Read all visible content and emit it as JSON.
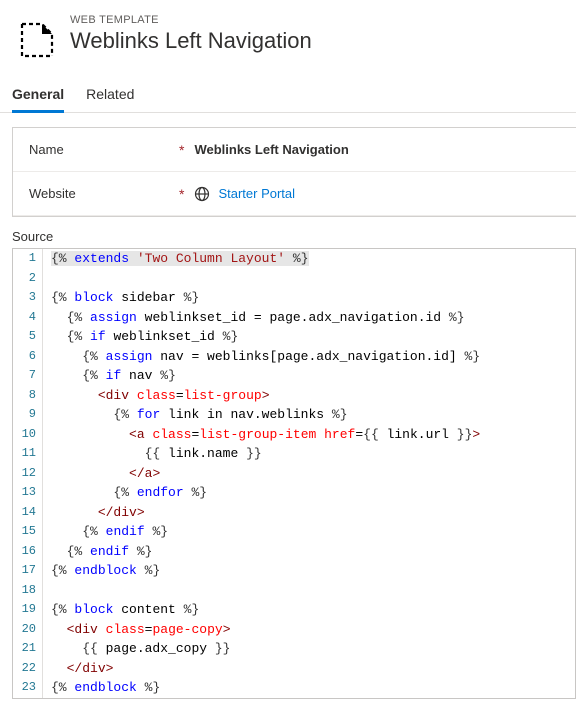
{
  "header": {
    "category": "WEB TEMPLATE",
    "title": "Weblinks Left Navigation"
  },
  "tabs": {
    "general": "General",
    "related": "Related"
  },
  "form": {
    "name_label": "Name",
    "name_value": "Weblinks Left Navigation",
    "website_label": "Website",
    "website_value": "Starter Portal",
    "required": "*"
  },
  "source_label": "Source",
  "code_lines": [
    {
      "n": "1",
      "tokens": [
        {
          "t": "{%",
          "c": "grey",
          "bg": true
        },
        {
          "t": " ",
          "bg": true
        },
        {
          "t": "extends",
          "c": "kw",
          "bg": true
        },
        {
          "t": " ",
          "bg": true
        },
        {
          "t": "'Two Column Layout'",
          "c": "val",
          "bg": true
        },
        {
          "t": " ",
          "bg": true
        },
        {
          "t": "%}",
          "c": "grey",
          "bg": true
        }
      ]
    },
    {
      "n": "2",
      "tokens": []
    },
    {
      "n": "3",
      "tokens": [
        {
          "t": "{%",
          "c": "grey"
        },
        {
          "t": " "
        },
        {
          "t": "block",
          "c": "kw"
        },
        {
          "t": " sidebar ",
          "c": "txt"
        },
        {
          "t": "%}",
          "c": "grey"
        }
      ]
    },
    {
      "n": "4",
      "tokens": [
        {
          "t": "  "
        },
        {
          "t": "{%",
          "c": "grey"
        },
        {
          "t": " "
        },
        {
          "t": "assign",
          "c": "kw"
        },
        {
          "t": " weblinkset_id = page.adx_navigation.id ",
          "c": "txt"
        },
        {
          "t": "%}",
          "c": "grey"
        }
      ]
    },
    {
      "n": "5",
      "tokens": [
        {
          "t": "  "
        },
        {
          "t": "{%",
          "c": "grey"
        },
        {
          "t": " "
        },
        {
          "t": "if",
          "c": "kw"
        },
        {
          "t": " weblinkset_id ",
          "c": "txt"
        },
        {
          "t": "%}",
          "c": "grey"
        }
      ]
    },
    {
      "n": "6",
      "tokens": [
        {
          "t": "    "
        },
        {
          "t": "{%",
          "c": "grey"
        },
        {
          "t": " "
        },
        {
          "t": "assign",
          "c": "kw"
        },
        {
          "t": " nav = weblinks[page.adx_navigation.id] ",
          "c": "txt"
        },
        {
          "t": "%}",
          "c": "grey"
        }
      ]
    },
    {
      "n": "7",
      "tokens": [
        {
          "t": "    "
        },
        {
          "t": "{%",
          "c": "grey"
        },
        {
          "t": " "
        },
        {
          "t": "if",
          "c": "kw"
        },
        {
          "t": " nav ",
          "c": "txt"
        },
        {
          "t": "%}",
          "c": "grey"
        }
      ]
    },
    {
      "n": "8",
      "tokens": [
        {
          "t": "      "
        },
        {
          "t": "<",
          "c": "tag"
        },
        {
          "t": "div",
          "c": "tag"
        },
        {
          "t": " "
        },
        {
          "t": "class",
          "c": "attr"
        },
        {
          "t": "=",
          "c": "txt"
        },
        {
          "t": "list-group",
          "c": "attr"
        },
        {
          "t": ">",
          "c": "tag"
        }
      ]
    },
    {
      "n": "9",
      "tokens": [
        {
          "t": "        "
        },
        {
          "t": "{%",
          "c": "grey"
        },
        {
          "t": " "
        },
        {
          "t": "for",
          "c": "kw"
        },
        {
          "t": " link in nav.weblinks ",
          "c": "txt"
        },
        {
          "t": "%}",
          "c": "grey"
        }
      ]
    },
    {
      "n": "10",
      "tokens": [
        {
          "t": "          "
        },
        {
          "t": "<",
          "c": "tag"
        },
        {
          "t": "a",
          "c": "tag"
        },
        {
          "t": " "
        },
        {
          "t": "class",
          "c": "attr"
        },
        {
          "t": "=",
          "c": "txt"
        },
        {
          "t": "list-group-item",
          "c": "attr"
        },
        {
          "t": " "
        },
        {
          "t": "href",
          "c": "attr"
        },
        {
          "t": "=",
          "c": "txt"
        },
        {
          "t": "{{",
          "c": "grey"
        },
        {
          "t": " link.url ",
          "c": "txt"
        },
        {
          "t": "}}",
          "c": "grey"
        },
        {
          "t": ">",
          "c": "tag"
        }
      ]
    },
    {
      "n": "11",
      "tokens": [
        {
          "t": "            "
        },
        {
          "t": "{{",
          "c": "grey"
        },
        {
          "t": " link.name ",
          "c": "txt"
        },
        {
          "t": "}}",
          "c": "grey"
        }
      ]
    },
    {
      "n": "12",
      "tokens": [
        {
          "t": "          "
        },
        {
          "t": "</",
          "c": "tag"
        },
        {
          "t": "a",
          "c": "tag"
        },
        {
          "t": ">",
          "c": "tag"
        }
      ]
    },
    {
      "n": "13",
      "tokens": [
        {
          "t": "        "
        },
        {
          "t": "{%",
          "c": "grey"
        },
        {
          "t": " "
        },
        {
          "t": "endfor",
          "c": "kw"
        },
        {
          "t": " "
        },
        {
          "t": "%}",
          "c": "grey"
        }
      ]
    },
    {
      "n": "14",
      "tokens": [
        {
          "t": "      "
        },
        {
          "t": "</",
          "c": "tag"
        },
        {
          "t": "div",
          "c": "tag"
        },
        {
          "t": ">",
          "c": "tag"
        }
      ]
    },
    {
      "n": "15",
      "tokens": [
        {
          "t": "    "
        },
        {
          "t": "{%",
          "c": "grey"
        },
        {
          "t": " "
        },
        {
          "t": "endif",
          "c": "kw"
        },
        {
          "t": " "
        },
        {
          "t": "%}",
          "c": "grey"
        }
      ]
    },
    {
      "n": "16",
      "tokens": [
        {
          "t": "  "
        },
        {
          "t": "{%",
          "c": "grey"
        },
        {
          "t": " "
        },
        {
          "t": "endif",
          "c": "kw"
        },
        {
          "t": " "
        },
        {
          "t": "%}",
          "c": "grey"
        }
      ]
    },
    {
      "n": "17",
      "tokens": [
        {
          "t": "{%",
          "c": "grey"
        },
        {
          "t": " "
        },
        {
          "t": "endblock",
          "c": "kw"
        },
        {
          "t": " "
        },
        {
          "t": "%}",
          "c": "grey"
        }
      ]
    },
    {
      "n": "18",
      "tokens": []
    },
    {
      "n": "19",
      "tokens": [
        {
          "t": "{%",
          "c": "grey"
        },
        {
          "t": " "
        },
        {
          "t": "block",
          "c": "kw"
        },
        {
          "t": " content ",
          "c": "txt"
        },
        {
          "t": "%}",
          "c": "grey"
        }
      ]
    },
    {
      "n": "20",
      "tokens": [
        {
          "t": "  "
        },
        {
          "t": "<",
          "c": "tag"
        },
        {
          "t": "div",
          "c": "tag"
        },
        {
          "t": " "
        },
        {
          "t": "class",
          "c": "attr"
        },
        {
          "t": "=",
          "c": "txt"
        },
        {
          "t": "page-copy",
          "c": "attr"
        },
        {
          "t": ">",
          "c": "tag"
        }
      ]
    },
    {
      "n": "21",
      "tokens": [
        {
          "t": "    "
        },
        {
          "t": "{{",
          "c": "grey"
        },
        {
          "t": " page.adx_copy ",
          "c": "txt"
        },
        {
          "t": "}}",
          "c": "grey"
        }
      ]
    },
    {
      "n": "22",
      "tokens": [
        {
          "t": "  "
        },
        {
          "t": "</",
          "c": "tag"
        },
        {
          "t": "div",
          "c": "tag"
        },
        {
          "t": ">",
          "c": "tag"
        }
      ]
    },
    {
      "n": "23",
      "tokens": [
        {
          "t": "{%",
          "c": "grey"
        },
        {
          "t": " "
        },
        {
          "t": "endblock",
          "c": "kw"
        },
        {
          "t": " "
        },
        {
          "t": "%}",
          "c": "grey"
        }
      ]
    }
  ]
}
